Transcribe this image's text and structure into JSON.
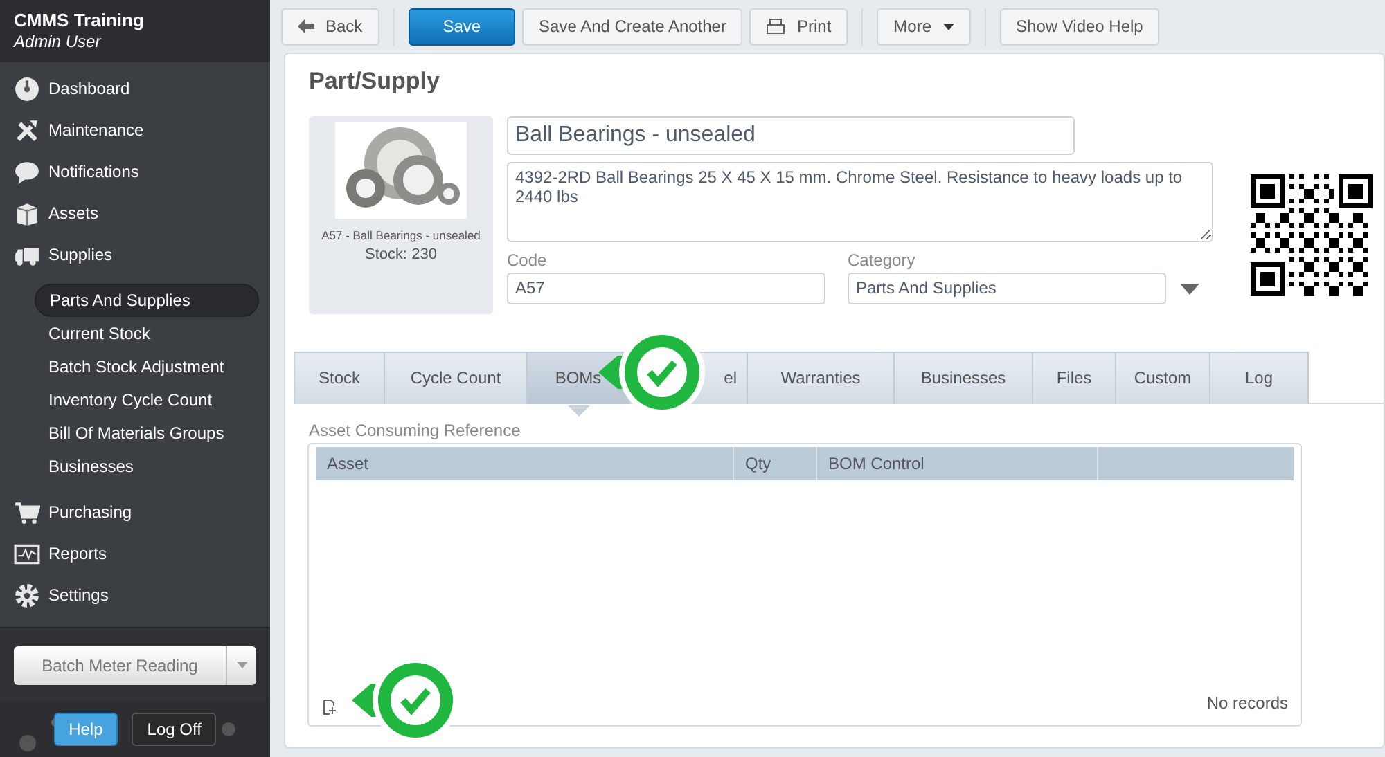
{
  "app": {
    "title": "CMMS Training",
    "user": "Admin User"
  },
  "sidebar": {
    "items": [
      {
        "label": "Dashboard",
        "selected": false
      },
      {
        "label": "Maintenance",
        "selected": false
      },
      {
        "label": "Notifications",
        "selected": false
      },
      {
        "label": "Assets",
        "selected": false
      },
      {
        "label": "Supplies",
        "selected": false,
        "children": [
          {
            "label": "Parts And Supplies",
            "selected": true
          },
          {
            "label": "Current Stock",
            "selected": false
          },
          {
            "label": "Batch Stock Adjustment",
            "selected": false
          },
          {
            "label": "Inventory Cycle Count",
            "selected": false
          },
          {
            "label": "Bill Of Materials Groups",
            "selected": false
          },
          {
            "label": "Businesses",
            "selected": false
          }
        ]
      },
      {
        "label": "Purchasing",
        "selected": false
      },
      {
        "label": "Reports",
        "selected": false
      },
      {
        "label": "Settings",
        "selected": false
      }
    ],
    "quick_action": {
      "label": "Batch Meter Reading"
    },
    "footer_buttons": [
      {
        "label": "Help",
        "kind": "primary"
      },
      {
        "label": "Log Off",
        "kind": "dark"
      }
    ]
  },
  "toolbar": [
    {
      "label": "Back",
      "kind": "back"
    },
    {
      "label": "Save",
      "kind": "primary"
    },
    {
      "label": "Save And Create Another",
      "kind": "plain"
    },
    {
      "label": "Print",
      "kind": "print"
    },
    {
      "label": "More",
      "kind": "dropdown"
    },
    {
      "label": "Show Video Help",
      "kind": "plain"
    }
  ],
  "form": {
    "title": "Part/Supply",
    "thumbnail": {
      "kind": "picture",
      "caption": "A57 - Ball Bearings - unsealed",
      "stock": "Stock: 230"
    },
    "name": "Ball Bearings - unsealed",
    "description": "4392-2RD Ball Bearings 25 X 45 X 15 mm. Chrome Steel. Resistance to heavy loads up to 2440 lbs",
    "code": {
      "label": "Code",
      "value": "A57"
    },
    "category": {
      "label": "Category",
      "value": "Parts And Supplies"
    }
  },
  "tabs": [
    {
      "label": "Stock",
      "selected": false
    },
    {
      "label": "Cycle Count",
      "selected": false
    },
    {
      "label": "BOMs",
      "selected": true
    },
    {
      "label": "el",
      "selected": false
    },
    {
      "label": "Warranties",
      "selected": false
    },
    {
      "label": "Businesses",
      "selected": false
    },
    {
      "label": "Files",
      "selected": false
    },
    {
      "label": "Custom",
      "selected": false
    },
    {
      "label": "Log",
      "selected": false
    }
  ],
  "grid": {
    "title": "Asset Consuming Reference",
    "columns": [
      "Asset",
      "Qty",
      "BOM Control"
    ],
    "empty_text": "No records"
  }
}
